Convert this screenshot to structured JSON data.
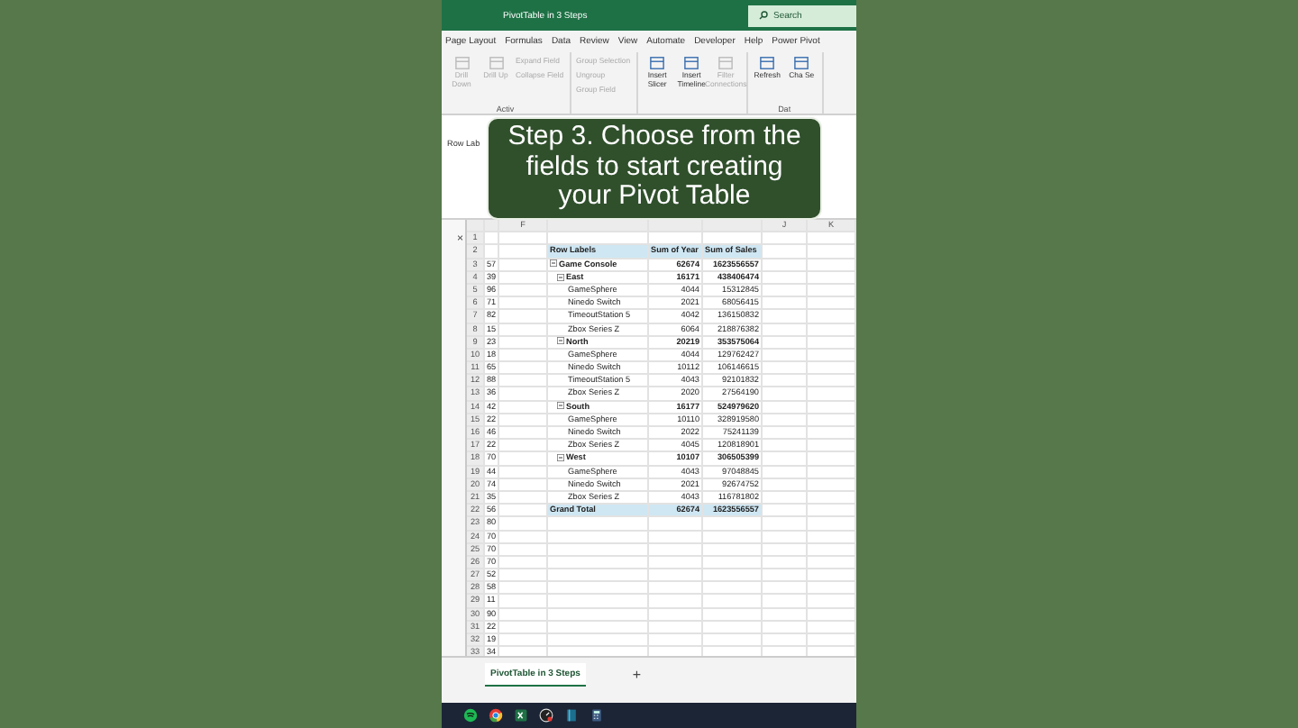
{
  "title_bar": {
    "title": "PivotTable in 3 Steps",
    "search": "Search"
  },
  "ribbon_tabs": [
    "Page Layout",
    "Formulas",
    "Data",
    "Review",
    "View",
    "Automate",
    "Developer",
    "Help",
    "Power Pivot"
  ],
  "ribbon_groups": [
    {
      "label": "Activ",
      "buttons": [
        {
          "kind": "large",
          "label": "Drill Down",
          "disabled": true
        },
        {
          "kind": "large",
          "label": "Drill Up",
          "disabled": true
        },
        {
          "kind": "small",
          "label": "Expand Field",
          "disabled": true
        },
        {
          "kind": "small",
          "label": "Collapse Field",
          "disabled": true
        }
      ]
    },
    {
      "buttons": [
        {
          "kind": "small",
          "label": "Group Selection",
          "disabled": true
        },
        {
          "kind": "small",
          "label": "Ungroup",
          "disabled": true
        },
        {
          "kind": "small",
          "label": "Group Field",
          "disabled": true
        }
      ]
    },
    {
      "buttons": [
        {
          "kind": "large",
          "label": "Insert Slicer",
          "disabled": false
        },
        {
          "kind": "large",
          "label": "Insert Timeline",
          "disabled": false
        },
        {
          "kind": "large",
          "label": "Filter Connections",
          "disabled": true
        }
      ]
    },
    {
      "label": "Dat",
      "buttons": [
        {
          "kind": "large",
          "label": "Refresh",
          "disabled": false
        },
        {
          "kind": "large",
          "label": "Cha Se",
          "disabled": false
        }
      ]
    }
  ],
  "name_box": "Row Lab",
  "caption": [
    "Step 3. Choose from the",
    "fields to start creating",
    "your Pivot Table"
  ],
  "column_headers": {
    "F": "F",
    "J": "J",
    "K": "K"
  },
  "side_pane": {
    "close": "×"
  },
  "row_numbers": [
    "1",
    "2",
    "3",
    "4",
    "5",
    "6",
    "7",
    "8",
    "9",
    "10",
    "11",
    "12",
    "13",
    "14",
    "15",
    "16",
    "17",
    "18",
    "19",
    "20",
    "21",
    "22",
    "23",
    "24",
    "25",
    "26",
    "27",
    "28",
    "29",
    "30",
    "31",
    "32",
    "33"
  ],
  "column_a": [
    "57",
    "39",
    "96",
    "71",
    "82",
    "15",
    "23",
    "18",
    "65",
    "88",
    "36",
    "42",
    "22",
    "46",
    "22",
    "70",
    "44",
    "74",
    "35",
    "56",
    "80",
    "70",
    "70",
    "70",
    "52",
    "58",
    "11",
    "90",
    "22",
    "19",
    "34"
  ],
  "pivot": {
    "header": [
      "Row Labels",
      "Sum of Year",
      "Sum of Sales"
    ],
    "rows": [
      {
        "kind": "total",
        "label": "Game Console",
        "year": "62674",
        "sales": "1623556557"
      },
      {
        "kind": "region",
        "label": "East",
        "year": "16171",
        "sales": "438406474"
      },
      {
        "kind": "item",
        "label": "GameSphere",
        "year": "4044",
        "sales": "15312845"
      },
      {
        "kind": "item",
        "label": "Ninedo Switch",
        "year": "2021",
        "sales": "68056415"
      },
      {
        "kind": "item",
        "label": "TimeoutStation 5",
        "year": "4042",
        "sales": "136150832"
      },
      {
        "kind": "item",
        "label": "Zbox Series Z",
        "year": "6064",
        "sales": "218876382"
      },
      {
        "kind": "region",
        "label": "North",
        "year": "20219",
        "sales": "353575064"
      },
      {
        "kind": "item",
        "label": "GameSphere",
        "year": "4044",
        "sales": "129762427"
      },
      {
        "kind": "item",
        "label": "Ninedo Switch",
        "year": "10112",
        "sales": "106146615"
      },
      {
        "kind": "item",
        "label": "TimeoutStation 5",
        "year": "4043",
        "sales": "92101832"
      },
      {
        "kind": "item",
        "label": "Zbox Series Z",
        "year": "2020",
        "sales": "27564190"
      },
      {
        "kind": "region",
        "label": "South",
        "year": "16177",
        "sales": "524979620"
      },
      {
        "kind": "item",
        "label": "GameSphere",
        "year": "10110",
        "sales": "328919580"
      },
      {
        "kind": "item",
        "label": "Ninedo Switch",
        "year": "2022",
        "sales": "75241139"
      },
      {
        "kind": "item",
        "label": "Zbox Series Z",
        "year": "4045",
        "sales": "120818901"
      },
      {
        "kind": "region",
        "label": "West",
        "year": "10107",
        "sales": "306505399"
      },
      {
        "kind": "item",
        "label": "GameSphere",
        "year": "4043",
        "sales": "97048845"
      },
      {
        "kind": "item",
        "label": "Ninedo Switch",
        "year": "2021",
        "sales": "92674752"
      },
      {
        "kind": "item",
        "label": "Zbox Series Z",
        "year": "4043",
        "sales": "116781802"
      },
      {
        "kind": "grand",
        "label": "Grand Total",
        "year": "62674",
        "sales": "1623556557"
      }
    ]
  },
  "sheet_tabs": [
    {
      "label": "PivotTable in 3 Steps",
      "selected": true
    }
  ],
  "add_sheet": "+"
}
